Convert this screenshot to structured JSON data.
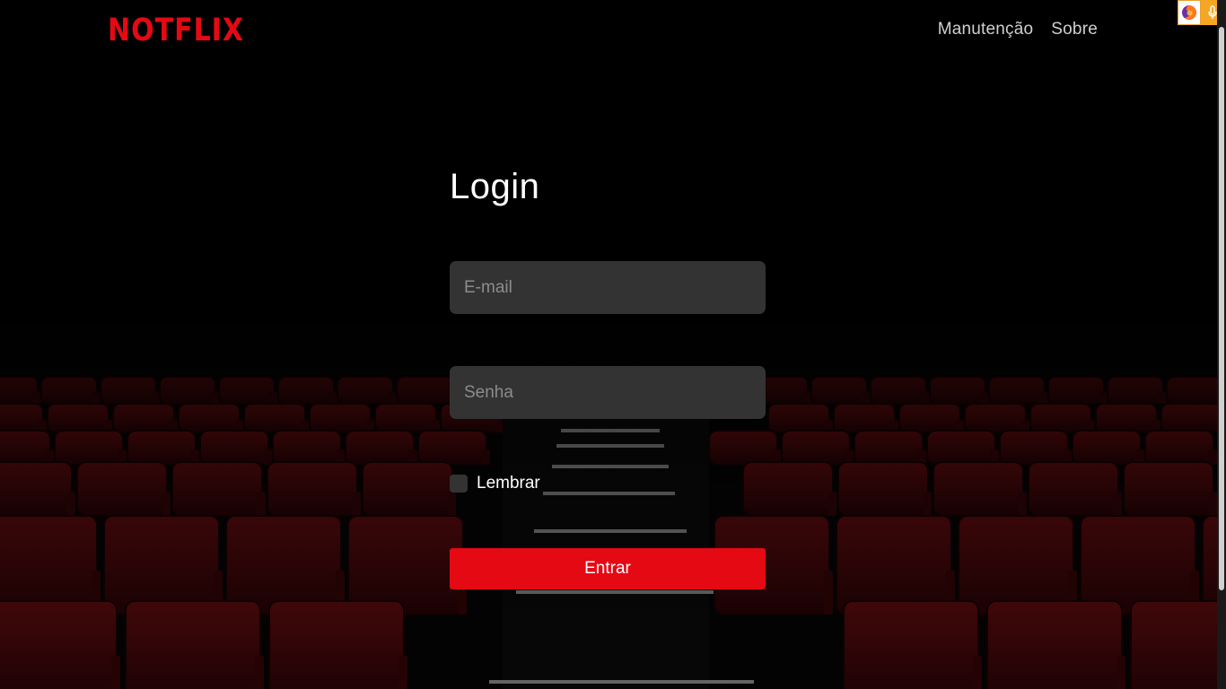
{
  "header": {
    "logo_text": "NOTFLIX",
    "nav": [
      {
        "label": "Manutenção"
      },
      {
        "label": "Sobre"
      }
    ]
  },
  "login": {
    "title": "Login",
    "email_placeholder": "E-mail",
    "password_placeholder": "Senha",
    "remember_label": "Lembrar",
    "submit_label": "Entrar"
  },
  "extensions": [
    {
      "icon": "firefox-icon"
    },
    {
      "icon": "microphone-icon"
    }
  ],
  "colors": {
    "brand_red": "#e50914",
    "input_bg": "#333333",
    "seat_red": "#5c0a0c",
    "background": "#000000"
  }
}
